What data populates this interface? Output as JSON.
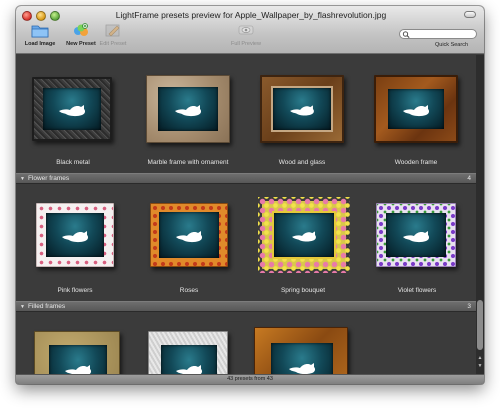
{
  "window": {
    "title": "LightFrame presets preview for Apple_Wallpaper_by_flashrevolution.jpg"
  },
  "toolbar": {
    "load_image": "Load Image",
    "new_preset": "New Preset",
    "edit_preset": "Edit Preset",
    "full_preview": "Full Preview",
    "quick_search_label": "Quick Search",
    "search_value": ""
  },
  "sections": [
    {
      "name": "",
      "count": "",
      "presets": [
        "Black metal",
        "Marble frame with ornament",
        "Wood and glass",
        "Wooden frame"
      ]
    },
    {
      "name": "Flower frames",
      "count": "4",
      "presets": [
        "Pink flowers",
        "Roses",
        "Spring bouquet",
        "Violet flowers"
      ]
    },
    {
      "name": "Filled frames",
      "count": "3",
      "presets": []
    }
  ],
  "status": {
    "text": "43 presets from 43"
  },
  "icons": {
    "traffic_red": "close-icon",
    "traffic_yellow": "minimize-icon",
    "traffic_green": "zoom-icon"
  },
  "colors": {
    "content_bg": "#3b3b3b",
    "section_header": "#5f5f5f",
    "picture_teal": "#124958"
  }
}
